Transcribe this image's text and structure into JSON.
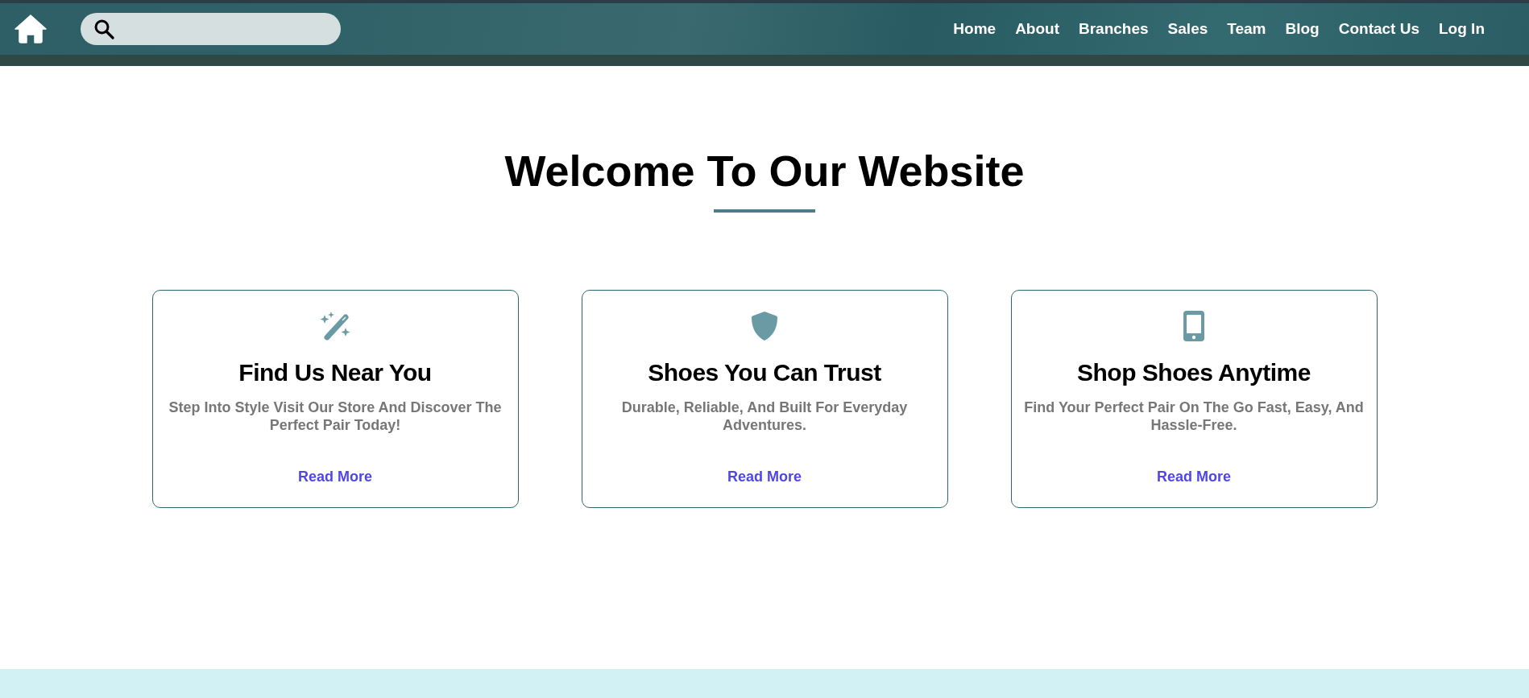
{
  "nav_links": [
    {
      "label": "Home"
    },
    {
      "label": "About"
    },
    {
      "label": "Branches"
    },
    {
      "label": "Sales"
    },
    {
      "label": "Team"
    },
    {
      "label": "Blog"
    },
    {
      "label": "Contact Us"
    },
    {
      "label": "Log In"
    }
  ],
  "hero": {
    "title": "Welcome To Our Website"
  },
  "cards": [
    {
      "kind": "wand",
      "title": "Find Us Near You",
      "description": "Step Into Style Visit Our Store And Discover The Perfect Pair Today!",
      "link": "Read More"
    },
    {
      "kind": "shield",
      "title": "Shoes You Can Trust",
      "description": "Durable, Reliable, And Built For Everyday Adventures.",
      "link": "Read More"
    },
    {
      "kind": "phone",
      "title": "Shop Shoes Anytime",
      "description": "Find Your Perfect Pair On The Go Fast, Easy, And Hassle-Free.",
      "link": "Read More"
    }
  ]
}
